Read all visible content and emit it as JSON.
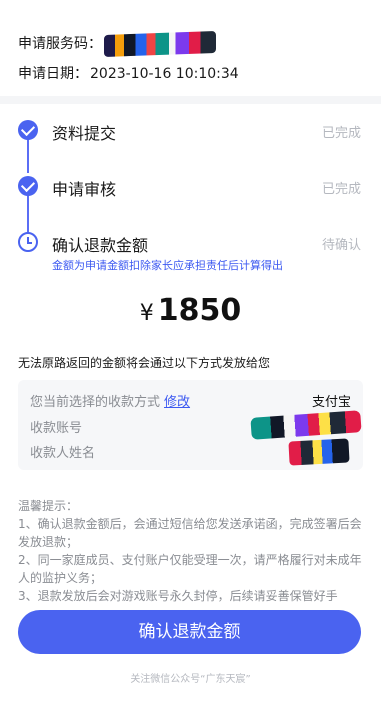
{
  "request": {
    "code_label": "申请服务码：",
    "date_label": "申请日期：",
    "date_value": "2023-10-16 10:10:34"
  },
  "steps": [
    {
      "label": "资料提交",
      "status": "已完成",
      "state": "done"
    },
    {
      "label": "申请审核",
      "status": "已完成",
      "state": "done"
    },
    {
      "label": "确认退款金额",
      "status": "待确认",
      "state": "pending"
    }
  ],
  "step_note": "金额为申请金额扣除家长应承担责任后计算得出",
  "amount": {
    "currency": "¥",
    "value": "1850"
  },
  "method_title": "无法原路返回的金额将会通过以下方式发放给您",
  "payment": {
    "current_label": "您当前选择的收款方式",
    "edit_label": "修改",
    "method_value": "支付宝",
    "account_label": "收款账号",
    "name_label": "收款人姓名"
  },
  "tips": {
    "title": "温馨提示：",
    "items": [
      "1、确认退款金额后，会通过短信给您发送承诺函，完成签署后会发放退款；",
      "2、同一家庭成员、支付账户仅能受理一次，请严格履行对未成年人的监护义务；",
      "3、退款发放后会对游戏账号永久封停，后续请妥善保管好手"
    ]
  },
  "confirm_button": "确认退款金额",
  "footer": "关注微信公众号“广东天宸”",
  "colors": {
    "accent": "#4a63f0",
    "link": "#3d5af1",
    "muted": "#b5b8bf"
  }
}
